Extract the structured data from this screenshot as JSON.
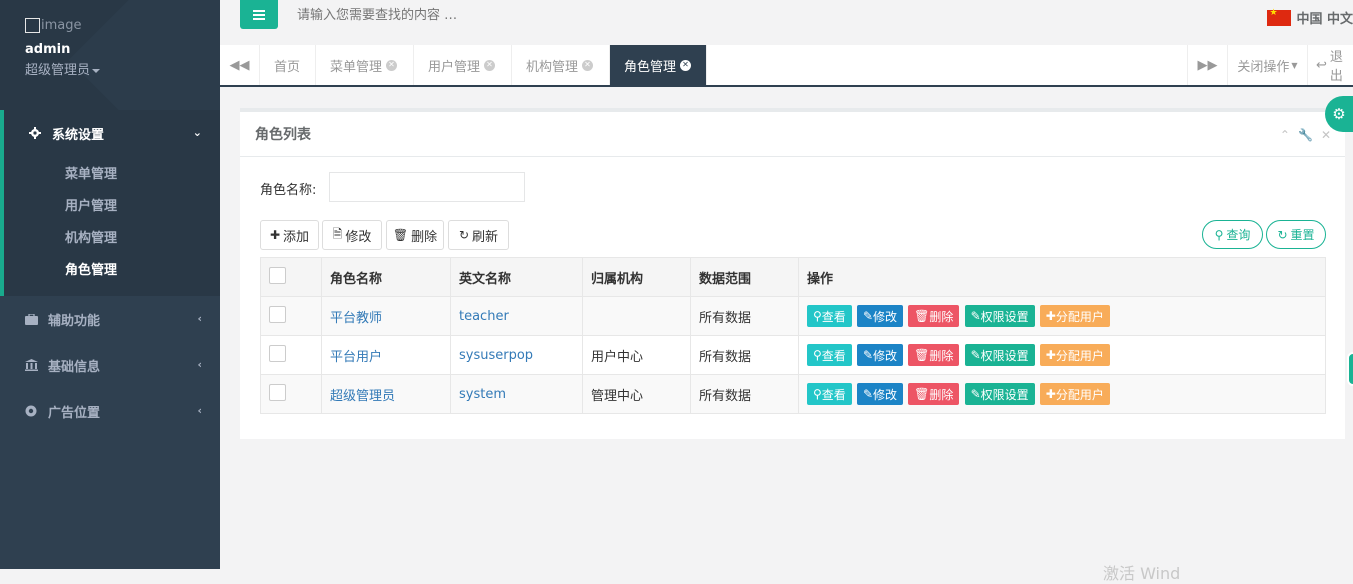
{
  "profile": {
    "image_alt": "image",
    "name": "admin",
    "role": "超级管理员"
  },
  "menu": {
    "groups": [
      {
        "label": "系统设置",
        "icon": "gear-icon",
        "items": [
          "菜单管理",
          "用户管理",
          "机构管理",
          "角色管理"
        ],
        "active_item": "角色管理"
      },
      {
        "label": "辅助功能",
        "icon": "briefcase-icon"
      },
      {
        "label": "基础信息",
        "icon": "bank-icon"
      },
      {
        "label": "广告位置",
        "icon": "chrome-icon"
      }
    ]
  },
  "topbar": {
    "search_placeholder": "请输入您需要查找的内容 …",
    "language": "中国 中文"
  },
  "tabs": {
    "items": [
      "首页",
      "菜单管理",
      "用户管理",
      "机构管理",
      "角色管理"
    ],
    "active": "角色管理",
    "close_ops": "关闭操作",
    "logout": "退出"
  },
  "panel": {
    "title": "角色列表",
    "search_label": "角色名称:",
    "buttons": {
      "add": "添加",
      "edit": "修改",
      "delete": "删除",
      "refresh": "刷新"
    },
    "query": "查询",
    "reset": "重置"
  },
  "table": {
    "columns": [
      "角色名称",
      "英文名称",
      "归属机构",
      "数据范围",
      "操作"
    ],
    "rows": [
      {
        "name": "平台教师",
        "en": "teacher",
        "org": "",
        "scope": "所有数据"
      },
      {
        "name": "平台用户",
        "en": "sysuserpop",
        "org": "用户中心",
        "scope": "所有数据"
      },
      {
        "name": "超级管理员",
        "en": "system",
        "org": "管理中心",
        "scope": "所有数据"
      }
    ],
    "actions": {
      "view": "查看",
      "edit": "修改",
      "delete": "删除",
      "perm": "权限设置",
      "assign": "分配用户"
    }
  },
  "watermark": "激活 Wind",
  "colors": {
    "sidebar": "#2f4050",
    "accent": "#1ab394",
    "link": "#337ab7",
    "danger": "#ed5565",
    "warning": "#f8ac59",
    "info": "#23c6c8",
    "primary": "#1c84c6"
  }
}
